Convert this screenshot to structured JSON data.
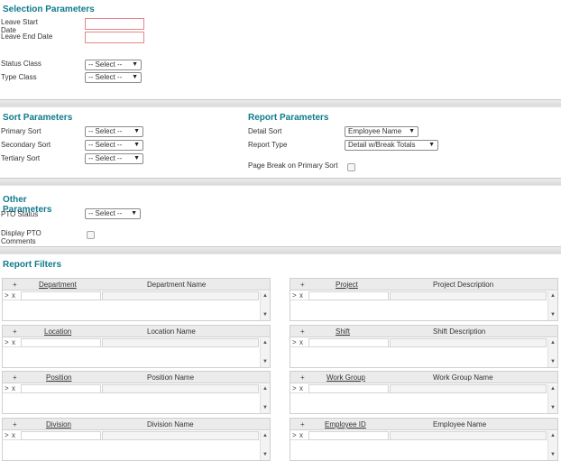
{
  "selection": {
    "title": "Selection Parameters",
    "leave_start_label": "Leave Start Date",
    "leave_end_label": "Leave End Date",
    "status_class_label": "Status Class",
    "status_class_value": "-- Select --",
    "type_class_label": "Type Class",
    "type_class_value": "-- Select --"
  },
  "sort": {
    "title": "Sort Parameters",
    "primary_label": "Primary Sort",
    "primary_value": "-- Select --",
    "secondary_label": "Secondary Sort",
    "secondary_value": "-- Select --",
    "tertiary_label": "Tertiary Sort",
    "tertiary_value": "-- Select --"
  },
  "report": {
    "title": "Report Parameters",
    "detail_sort_label": "Detail Sort",
    "detail_sort_value": "Employee Name",
    "report_type_label": "Report Type",
    "report_type_value": "Detail w/Break Totals",
    "page_break_label": "Page Break on Primary Sort"
  },
  "other": {
    "title": "Other Parameters",
    "pto_status_label": "PTO Status",
    "pto_status_value": "-- Select --",
    "display_pto_label": "Display PTO Comments"
  },
  "filters": {
    "title": "Report Filters",
    "add_symbol": "+",
    "row_expand": ">",
    "row_remove": "x",
    "up_arrow": "▲",
    "down_arrow": "▼",
    "items": [
      {
        "col1": "Department",
        "col2": "Department Name"
      },
      {
        "col1": "Project",
        "col2": "Project Description"
      },
      {
        "col1": "Location",
        "col2": "Location Name"
      },
      {
        "col1": "Shift",
        "col2": "Shift Description"
      },
      {
        "col1": "Position",
        "col2": "Position Name"
      },
      {
        "col1": "Work Group",
        "col2": "Work Group Name"
      },
      {
        "col1": "Division",
        "col2": "Division Name"
      },
      {
        "col1": "Employee ID",
        "col2": "Employee Name"
      }
    ]
  },
  "dropdown_arrow": "▼"
}
